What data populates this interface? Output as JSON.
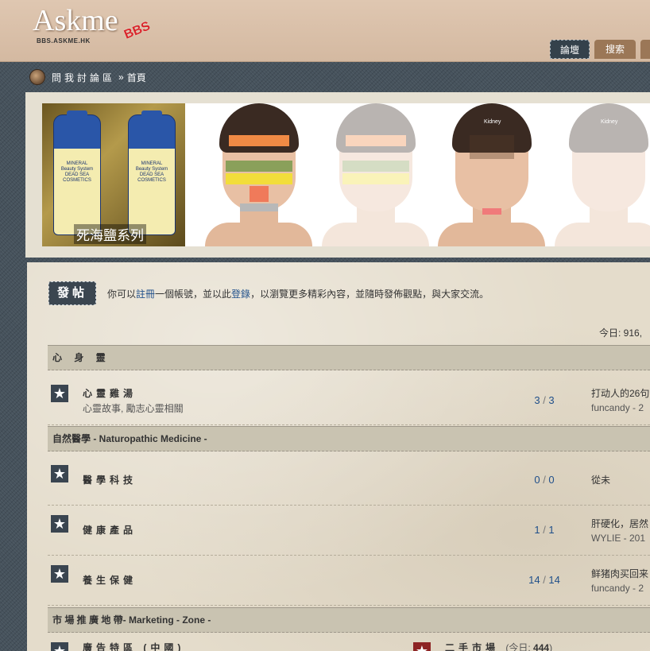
{
  "header": {
    "logo_main": "Askme",
    "logo_bbs": "BBS",
    "logo_sub": "BBS.ASKME.HK",
    "tabs": [
      {
        "label": "論壇"
      },
      {
        "label": "搜索"
      }
    ]
  },
  "breadcrumb": {
    "site": "問我討論區",
    "separator": "»",
    "current": "首頁"
  },
  "banner": {
    "caption": "死海鹽系列",
    "bottle_label": "MINERAL Beauty System DEAD SEA COSMETICS",
    "face_labels": [
      "Kidney",
      "Kidney"
    ]
  },
  "notice": {
    "post_button": "發帖",
    "prefix": "你可以",
    "register": "註冊",
    "middle": "一個帳號，並以此",
    "login": "登錄",
    "suffix": "，以瀏覽更多精彩內容，並隨時發佈觀點，與大家交流。"
  },
  "stats": {
    "today": "今日: 916,"
  },
  "categories": [
    {
      "title": "心 身 靈",
      "forums": [
        {
          "name": "心靈雞湯",
          "desc": "心靈故事, 勵志心靈相關",
          "topics": "3",
          "posts": "3",
          "last_title": "打动人的26句",
          "last_meta": "funcandy - 2"
        }
      ]
    },
    {
      "title": "自然醫學 - Naturopathic Medicine -",
      "forums": [
        {
          "name": "醫學科技",
          "desc": "",
          "topics": "0",
          "posts": "0",
          "last_title": "從未",
          "last_meta": ""
        },
        {
          "name": "健康產品",
          "desc": "",
          "topics": "1",
          "posts": "1",
          "last_title": "肝硬化，居然",
          "last_meta": "WYLIE - 201"
        },
        {
          "name": "養生保健",
          "desc": "",
          "topics": "14",
          "posts": "14",
          "last_title": "鲜猪肉买回来",
          "last_meta": "funcandy - 2"
        }
      ]
    },
    {
      "title": "市 場 推 廣 地 帶- Marketing - Zone -",
      "forums": []
    }
  ],
  "bottom": {
    "forum1": "廣告特區 (中國)",
    "forum2": "二手市場",
    "forum2_today": "(今日: ",
    "forum2_today_num": "444",
    "forum2_close": ")"
  },
  "colors": {
    "header_bg": "#d9bfa8",
    "tab_active": "#34414b",
    "tab_inactive": "#9b7757",
    "link": "#1f4f8a",
    "category_bg": "#c9c3b1"
  }
}
